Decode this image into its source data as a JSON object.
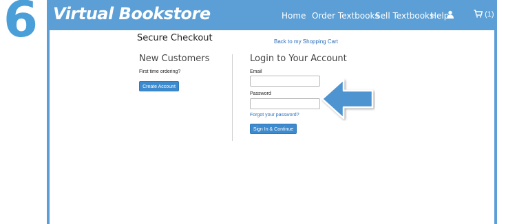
{
  "step": "6",
  "header": {
    "logo": "Virtual Bookstore",
    "nav": [
      "Home",
      "Order Textbooks",
      "Sell Textbooks",
      "Help"
    ],
    "cart_count": "(1)"
  },
  "page": {
    "title": "Secure Checkout",
    "back_link": "Back to my Shopping Cart"
  },
  "new_customers": {
    "heading": "New Customers",
    "prompt": "First time ordering?",
    "button": "Create Account"
  },
  "login": {
    "heading": "Login to Your Account",
    "email_label": "Email",
    "email_value": "",
    "password_label": "Password",
    "password_value": "",
    "forgot": "Forgot your password?",
    "button": "Sign In & Continue"
  },
  "colors": {
    "brand": "#5b9fd6",
    "button": "#3d8bcf",
    "step_number": "#4a9fd8"
  },
  "icons": [
    "user-icon",
    "cart-icon",
    "arrow-left-icon"
  ]
}
